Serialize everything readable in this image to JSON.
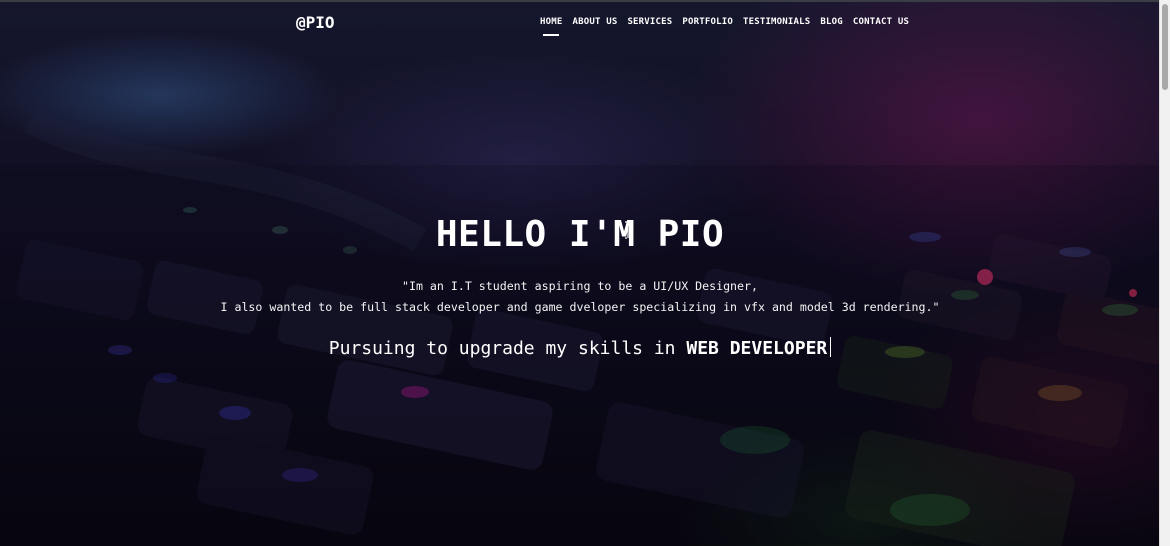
{
  "brand": {
    "logo": "@PIO"
  },
  "nav": {
    "items": [
      {
        "label": "HOME",
        "active": true
      },
      {
        "label": "ABOUT US",
        "active": false
      },
      {
        "label": "SERVICES",
        "active": false
      },
      {
        "label": "PORTFOLIO",
        "active": false
      },
      {
        "label": "TESTIMONIALS",
        "active": false
      },
      {
        "label": "BLOG",
        "active": false
      },
      {
        "label": "CONTACT US",
        "active": false
      }
    ]
  },
  "hero": {
    "title": "HELLO I'M PIO",
    "description_line1": "\"Im an I.T student aspiring to be a UI/UX Designer,",
    "description_line2": "I also wanted to be full stack developer and game dveloper specializing in vfx and model 3d rendering.\"",
    "typing_prefix": "Pursuing to upgrade my skills in",
    "typing_highlight": "WEB DEVELOPER",
    "background": "blurred backlit keyboard photo"
  },
  "colors": {
    "text": "#ffffff",
    "overlay": "#080614",
    "accent_magenta": "#961e6e",
    "accent_blue": "#4678be"
  },
  "icons": {
    "mouse_pointer": "text-cursor-icon"
  }
}
